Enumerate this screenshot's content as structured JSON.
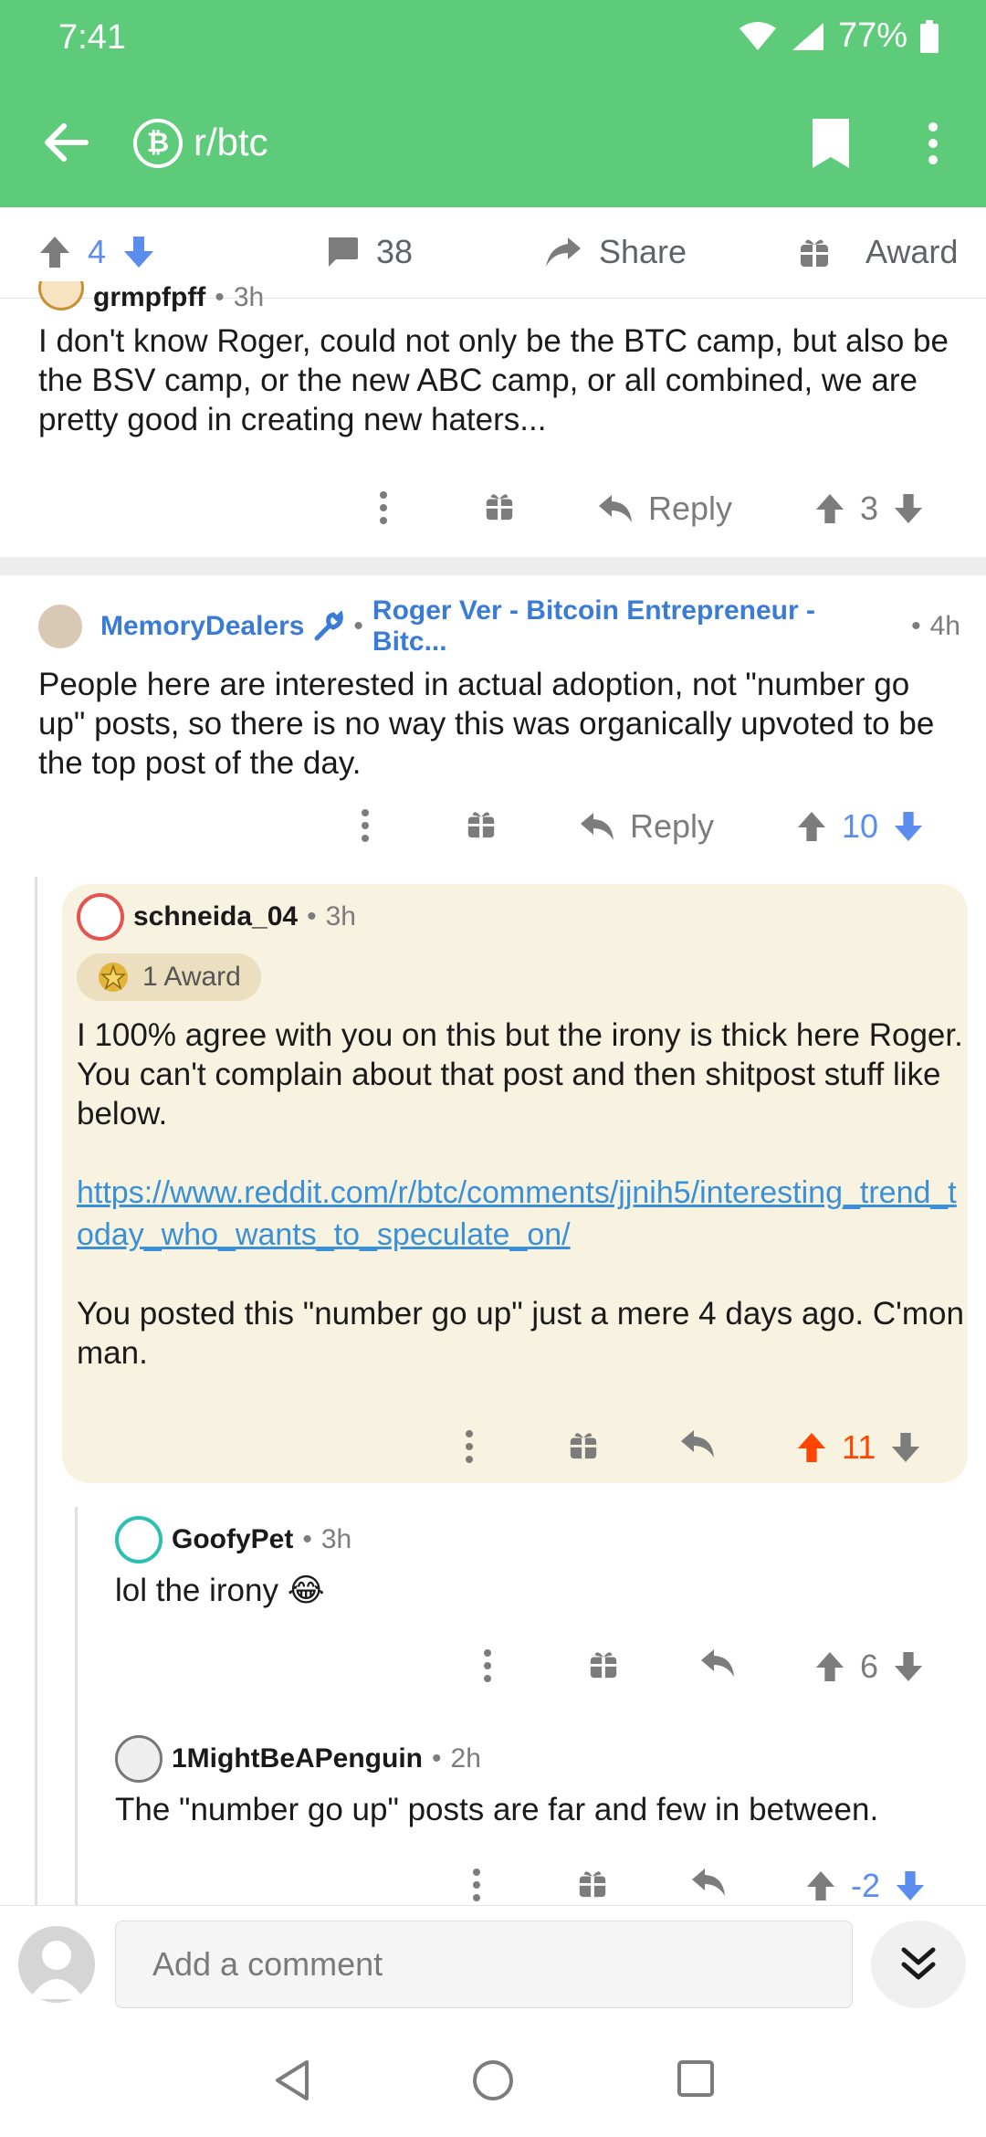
{
  "status_bar": {
    "time": "7:41",
    "battery": "77%"
  },
  "header": {
    "subreddit": "r/btc",
    "logo_letter": "₿"
  },
  "post_actions": {
    "score": "4",
    "comments": "38",
    "share": "Share",
    "award": "Award"
  },
  "comments": [
    {
      "user": "grmpfpff",
      "age": "3h",
      "body": "I don't know Roger, could not only be the BTC camp, but also be the BSV camp, or the new ABC camp, or all combined, we are pretty good in creating new haters...",
      "reply": "Reply",
      "score": "3"
    },
    {
      "user": "MemoryDealers",
      "flair": "Roger Ver - Bitcoin Entrepreneur - Bitc...",
      "age": "4h",
      "body": "People here are interested in actual adoption, not \"number go up\" posts, so there is no way this was organically upvoted to be the top post of the day.",
      "reply": "Reply",
      "score": "10"
    },
    {
      "user": "schneida_04",
      "age": "3h",
      "award": "1 Award",
      "body1": "I 100% agree with you on this but the irony is thick here Roger.  You can't complain about that post and then shitpost stuff like below.",
      "link": "https://www.reddit.com/r/btc/comments/jjnih5/interesting_trend_today_who_wants_to_speculate_on/",
      "body2": "You posted this \"number go up\" just a mere 4 days ago. C'mon man.",
      "score": "11"
    },
    {
      "user": "GoofyPet",
      "age": "3h",
      "body": "lol the irony 😂",
      "score": "6"
    },
    {
      "user": "1MightBeAPenguin",
      "age": "2h",
      "body": "The \"number go up\" posts are far and few in between.",
      "score": "-2"
    }
  ],
  "composer": {
    "placeholder": "Add a comment"
  },
  "colors": {
    "header": "#5ecb7b",
    "upvote": "#ff4500",
    "downvote": "#5b8def",
    "link": "#3a90d8",
    "highlight": "#f8f3e0"
  },
  "icons": [
    "back-arrow-icon",
    "bookmark-icon",
    "more-icon",
    "upvote-icon",
    "downvote-icon",
    "comment-icon",
    "share-icon",
    "gift-icon",
    "reply-icon",
    "jump-down-icon"
  ]
}
